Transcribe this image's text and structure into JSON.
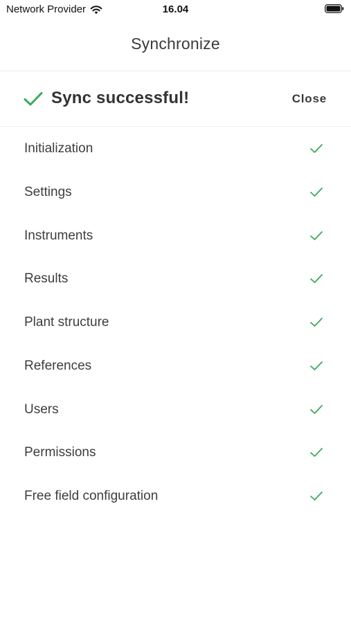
{
  "status_bar": {
    "carrier": "Network Provider",
    "time": "16.04"
  },
  "nav": {
    "title": "Synchronize"
  },
  "sync": {
    "title": "Sync successful!",
    "close_label": "Close",
    "accent_color": "#3aaa5b"
  },
  "items": [
    {
      "label": "Initialization",
      "status": "done"
    },
    {
      "label": "Settings",
      "status": "done"
    },
    {
      "label": "Instruments",
      "status": "done"
    },
    {
      "label": "Results",
      "status": "done"
    },
    {
      "label": "Plant structure",
      "status": "done"
    },
    {
      "label": "References",
      "status": "done"
    },
    {
      "label": "Users",
      "status": "done"
    },
    {
      "label": "Permissions",
      "status": "done"
    },
    {
      "label": "Free field configuration",
      "status": "done"
    }
  ]
}
